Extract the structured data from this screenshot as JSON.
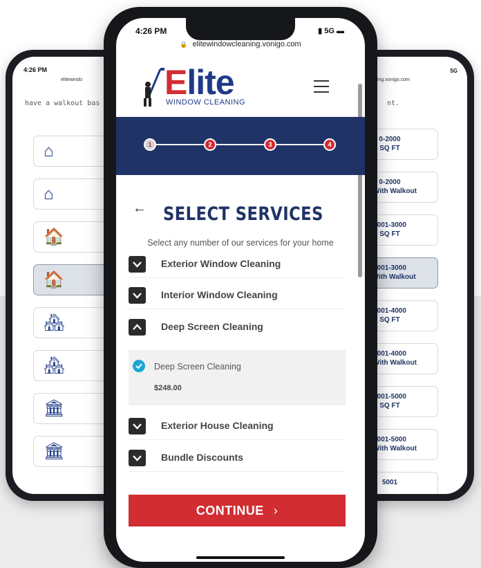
{
  "left_phone": {
    "time": "4:26 PM",
    "url": "elitewindo",
    "note": "have a walkout bas",
    "tiles": [
      {
        "icon": "house-1-icon",
        "selected": false
      },
      {
        "icon": "house-1-icon",
        "selected": false
      },
      {
        "icon": "house-2-icon",
        "selected": false
      },
      {
        "icon": "house-2-icon",
        "selected": true
      },
      {
        "icon": "house-3-icon",
        "selected": false
      },
      {
        "icon": "house-3-icon",
        "selected": false
      },
      {
        "icon": "house-4-icon",
        "selected": false
      },
      {
        "icon": "house-4-icon",
        "selected": false
      }
    ]
  },
  "right_phone": {
    "url": "ning.vonigo.com",
    "signal": "5G",
    "note": "nt.",
    "tiles": [
      {
        "line1": "0-2000",
        "line2": "SQ FT",
        "selected": false
      },
      {
        "line1": "0-2000",
        "line2": "FT With Walkout",
        "selected": false
      },
      {
        "line1": "2001-3000",
        "line2": "SQ FT",
        "selected": false
      },
      {
        "line1": "2001-3000",
        "line2": "Ft With Walkout",
        "selected": true
      },
      {
        "line1": "3001-4000",
        "line2": "SQ FT",
        "selected": false
      },
      {
        "line1": "3001-4000",
        "line2": "FT With Walkout",
        "selected": false
      },
      {
        "line1": "4001-5000",
        "line2": "SQ FT",
        "selected": false
      },
      {
        "line1": "4001-5000",
        "line2": "FT With Walkout",
        "selected": false
      },
      {
        "line1": "5001",
        "line2": "",
        "selected": false
      }
    ]
  },
  "status": {
    "time": "4:26 PM",
    "network": "5G"
  },
  "browser": {
    "url": "elitewindowcleaning.vonigo.com"
  },
  "logo": {
    "brand_first": "E",
    "brand_rest": "lite",
    "tagline": "WINDOW CLEANING"
  },
  "steps": [
    {
      "label": "1",
      "state": "done"
    },
    {
      "label": "2",
      "state": "todo"
    },
    {
      "label": "3",
      "state": "todo"
    },
    {
      "label": "4",
      "state": "todo"
    }
  ],
  "page": {
    "title": "SELECT SERVICES",
    "subtitle": "Select any number of our services for your home"
  },
  "accordions": [
    {
      "label": "Exterior Window Cleaning",
      "expanded": false
    },
    {
      "label": "Interior Window Cleaning",
      "expanded": false
    },
    {
      "label": "Deep Screen Cleaning",
      "expanded": true
    },
    {
      "label": "Exterior House Cleaning",
      "expanded": false
    },
    {
      "label": "Bundle Discounts",
      "expanded": false
    }
  ],
  "deep_screen_option": {
    "label": "Deep Screen Cleaning",
    "price": "$248.00",
    "checked": true
  },
  "continue": {
    "label": "CONTINUE",
    "chevron": "›"
  },
  "colors": {
    "navy": "#1f3366",
    "red": "#d12d33",
    "check": "#1aa7d8"
  }
}
